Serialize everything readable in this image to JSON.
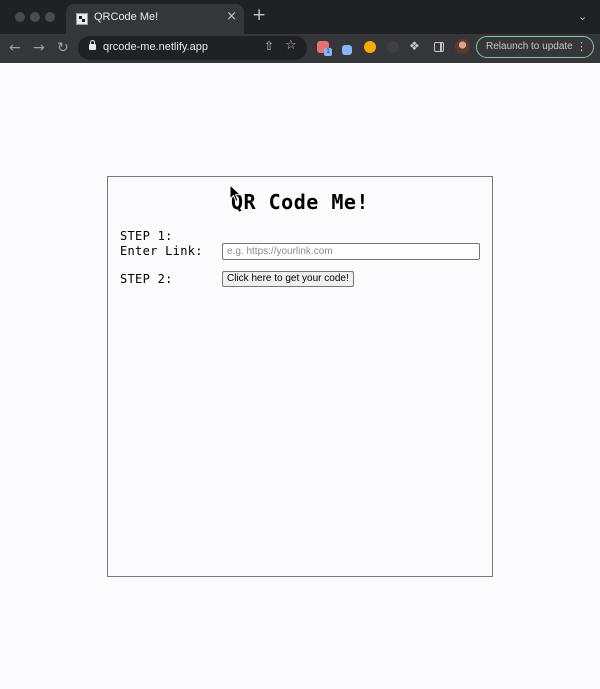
{
  "browser": {
    "tab_title": "QRCode Me!",
    "tab_close": "×",
    "new_tab": "+",
    "tab_dropdown": "⌄",
    "url": "qrcode-me.netlify.app",
    "extension_badge": "1",
    "relaunch_label": "Relaunch to update",
    "menu_glyph": "⋮"
  },
  "page": {
    "title": "QR Code Me!",
    "step1_label": "STEP 1:",
    "enter_link_label": "Enter Link:",
    "link_input": {
      "value": "",
      "placeholder": "e.g. https://yourlink.com"
    },
    "step2_label": "STEP 2:",
    "get_code_button": "Click here to get your code!"
  },
  "colors": {
    "chrome_dark": "#202124",
    "chrome_toolbar": "#35363a",
    "relaunch_border": "#81c995",
    "page_bg": "#fbfafc"
  }
}
